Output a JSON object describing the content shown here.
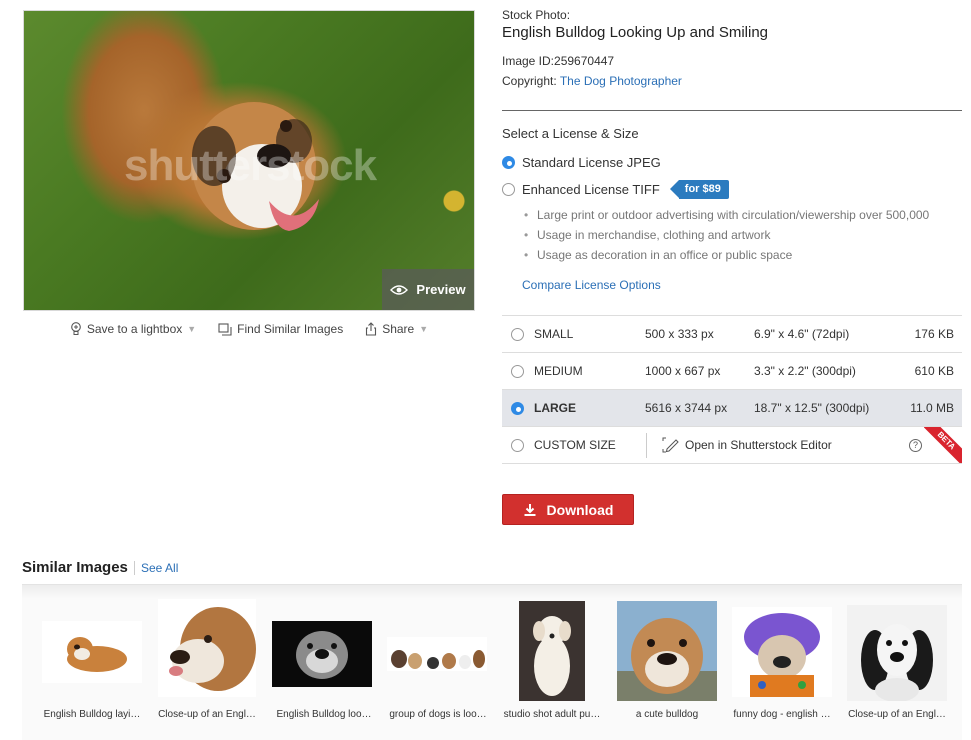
{
  "photo": {
    "watermark": "shutterstock",
    "preview_label": "Preview"
  },
  "actions": {
    "save": "Save to a lightbox",
    "similar": "Find Similar Images",
    "share": "Share"
  },
  "details": {
    "stock_label": "Stock Photo:",
    "title": "English Bulldog Looking Up and Smiling",
    "image_id": "Image ID:259670447",
    "copyright_label": "Copyright:",
    "copyright_name": "The Dog Photographer"
  },
  "license": {
    "heading": "Select a License & Size",
    "standard": "Standard License JPEG",
    "enhanced": "Enhanced License TIFF",
    "enhanced_price": "for $89",
    "features": [
      "Large print or outdoor advertising with circulation/viewership over 500,000",
      "Usage in merchandise, clothing and artwork",
      "Usage as decoration in an office or public space"
    ],
    "compare": "Compare License Options"
  },
  "sizes": [
    {
      "name": "SMALL",
      "px": "500 x 333 px",
      "inches": "6.9\" x 4.6\" (72dpi)",
      "size": "176 KB"
    },
    {
      "name": "MEDIUM",
      "px": "1000 x 667 px",
      "inches": "3.3\" x 2.2\" (300dpi)",
      "size": "610 KB"
    },
    {
      "name": "LARGE",
      "px": "5616 x 3744 px",
      "inches": "18.7\" x 12.5\" (300dpi)",
      "size": "11.0 MB"
    }
  ],
  "custom": {
    "name": "CUSTOM SIZE",
    "editor": "Open in Shutterstock Editor",
    "help": "?",
    "beta": "BETA"
  },
  "download_label": "Download",
  "similar": {
    "title": "Similar Images",
    "see_all": "See All",
    "captions": [
      "English Bulldog layi…",
      "Close-up of an Engl…",
      "English Bulldog loo…",
      "group of dogs is loo…",
      "studio shot adult pu…",
      "a cute bulldog",
      "funny dog - english …",
      "Close-up of an Engl…"
    ]
  },
  "colors": {
    "link": "#2b6fb6",
    "radio_selected": "#2f8ae5",
    "price_tag": "#2b7bbf",
    "download": "#d2302e",
    "selected_row": "#e3e5ea",
    "beta": "#d9242e"
  }
}
